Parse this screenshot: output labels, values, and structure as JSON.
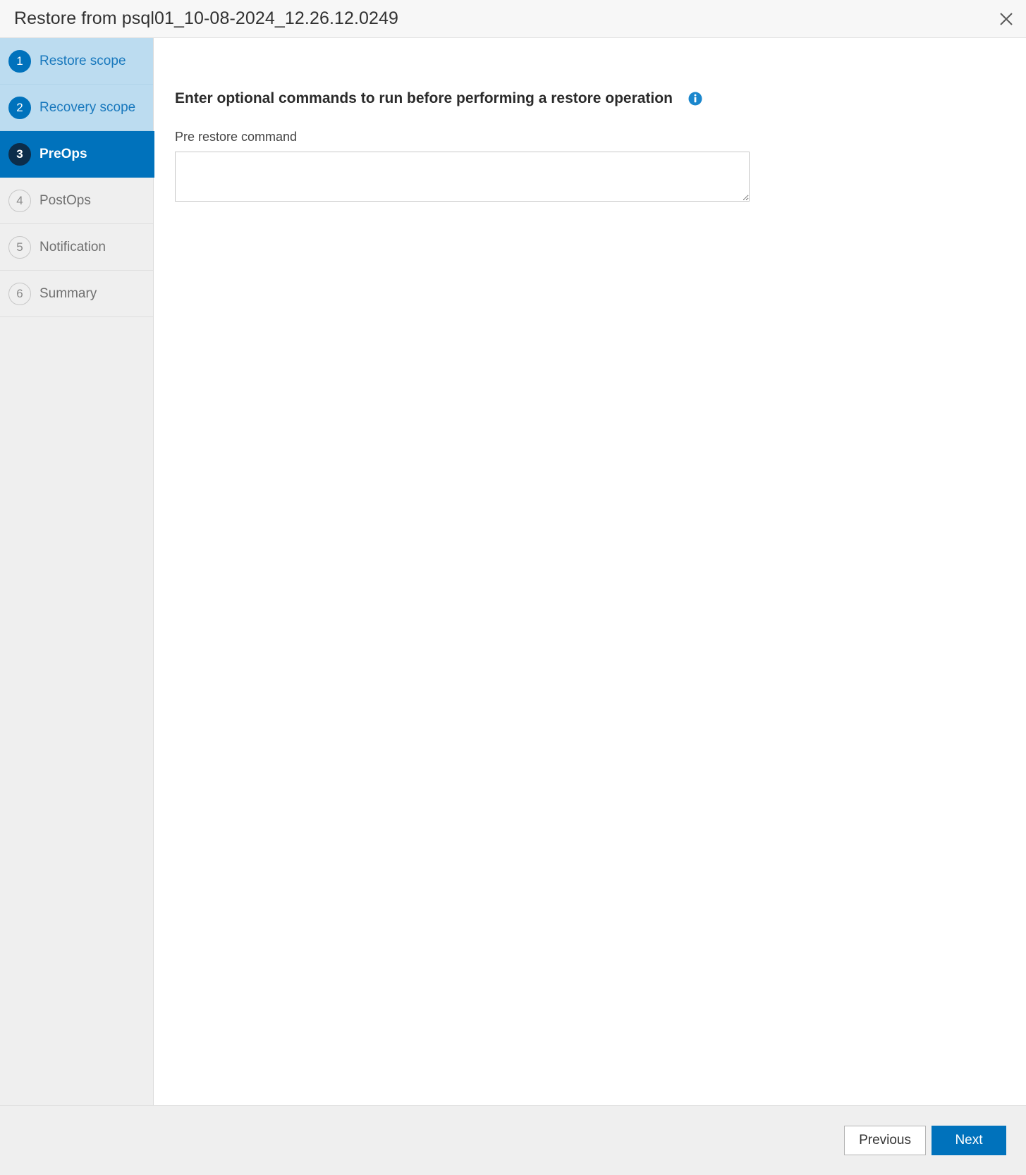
{
  "dialog": {
    "title": "Restore from psql01_10-08-2024_12.26.12.0249",
    "close_icon": "close-icon"
  },
  "sidebar": {
    "steps": [
      {
        "number": "1",
        "label": "Restore scope",
        "state": "done"
      },
      {
        "number": "2",
        "label": "Recovery scope",
        "state": "done"
      },
      {
        "number": "3",
        "label": "PreOps",
        "state": "active"
      },
      {
        "number": "4",
        "label": "PostOps",
        "state": "todo"
      },
      {
        "number": "5",
        "label": "Notification",
        "state": "todo"
      },
      {
        "number": "6",
        "label": "Summary",
        "state": "todo"
      }
    ]
  },
  "content": {
    "heading": "Enter optional commands to run before performing a restore operation",
    "info_icon": "info-icon",
    "pre_restore": {
      "label": "Pre restore command",
      "value": "",
      "placeholder": ""
    }
  },
  "footer": {
    "previous_label": "Previous",
    "next_label": "Next"
  },
  "colors": {
    "accent_blue": "#0072bc",
    "active_badge": "#0c2d4a",
    "done_row_bg": "#bcdcf0",
    "done_text": "#1878bd",
    "sidebar_bg": "#efefef",
    "footer_bg": "#efefef",
    "title_bar_bg": "#f7f7f7"
  }
}
